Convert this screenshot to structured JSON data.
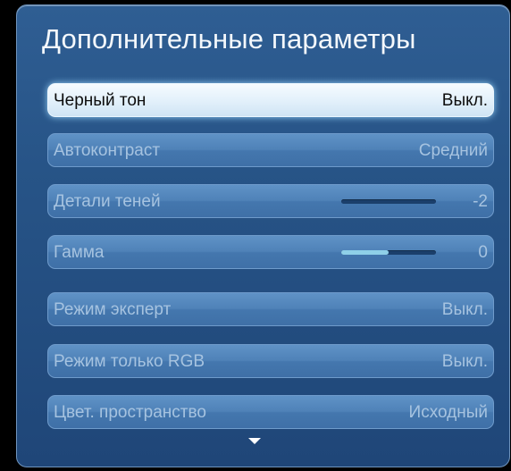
{
  "menu": {
    "title": "Дополнительные параметры",
    "items": [
      {
        "label": "Черный тон",
        "value": "Выкл.",
        "selected": true
      },
      {
        "label": "Автоконтраст",
        "value": "Средний"
      },
      {
        "label": "Детали теней",
        "value": "-2",
        "slider_fill_fraction": 0.0
      },
      {
        "label": "Гамма",
        "value": "0",
        "slider_fill_fraction": 0.5
      },
      {
        "label": "Режим эксперт",
        "value": "Выкл."
      },
      {
        "label": "Режим только RGB",
        "value": "Выкл."
      },
      {
        "label": "Цвет. пространство",
        "value": "Исходный"
      }
    ],
    "scroll_icon": "chevron-down-icon"
  },
  "colors": {
    "panel": "#275487",
    "item": "#4f82b8",
    "selected_item": "#e4f1fb",
    "slider_fill": "#8fd0e8"
  }
}
